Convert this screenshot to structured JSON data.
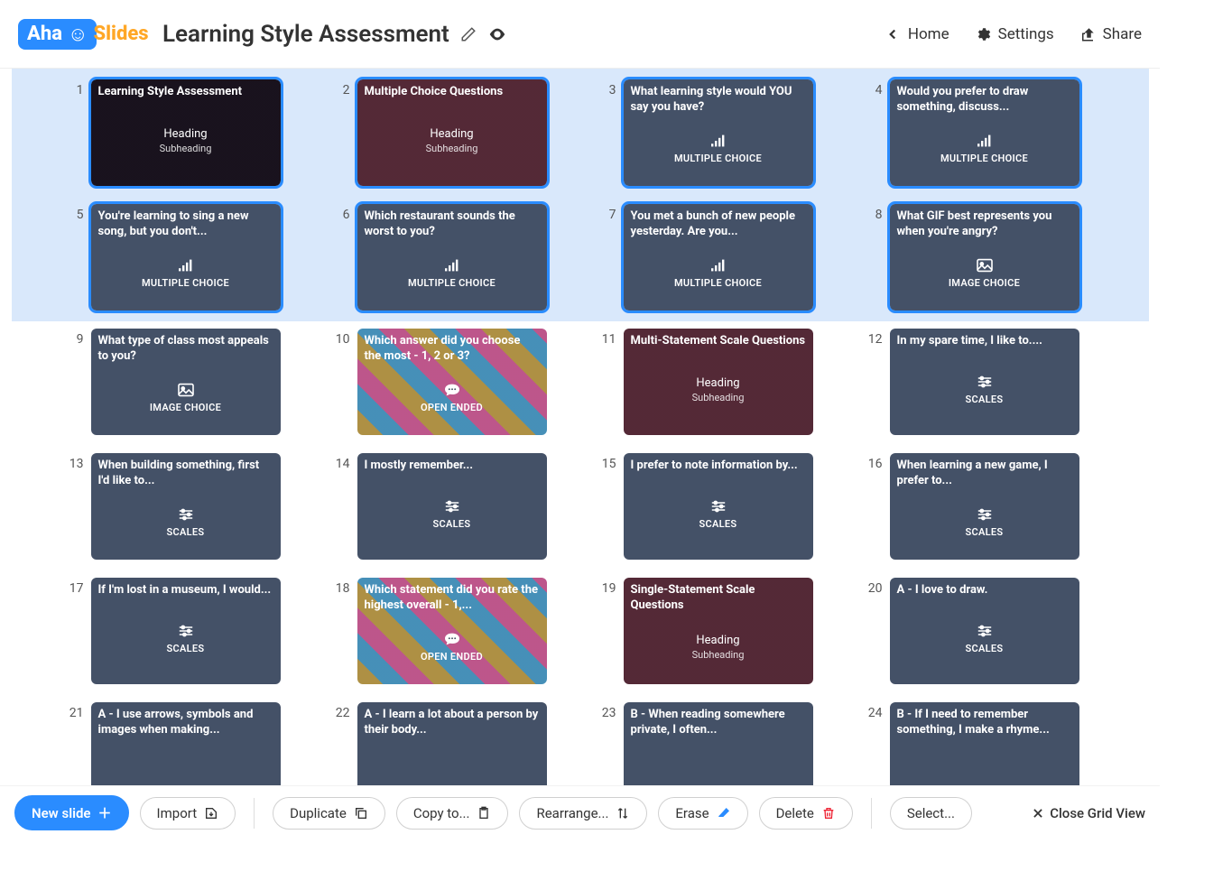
{
  "header": {
    "logo_text1": "Aha",
    "logo_text2": "Slides",
    "title": "Learning Style Assessment",
    "home": "Home",
    "settings": "Settings",
    "share": "Share"
  },
  "slides": [
    {
      "n": 1,
      "title": "Learning Style Assessment",
      "heading": "Heading",
      "sub": "Subheading",
      "type": "",
      "icon": "",
      "bg": "bg-dark",
      "sel": true
    },
    {
      "n": 2,
      "title": "Multiple Choice Questions",
      "heading": "Heading",
      "sub": "Subheading",
      "type": "",
      "icon": "",
      "bg": "bg-burg",
      "sel": true
    },
    {
      "n": 3,
      "title": "What learning style would YOU say you have?",
      "heading": "",
      "sub": "",
      "type": "MULTIPLE CHOICE",
      "icon": "bars",
      "bg": "bg-slate",
      "sel": true
    },
    {
      "n": 4,
      "title": "Would you prefer to draw something, discuss...",
      "heading": "",
      "sub": "",
      "type": "MULTIPLE CHOICE",
      "icon": "bars",
      "bg": "bg-slate",
      "sel": true
    },
    {
      "n": 5,
      "title": "You're learning to sing a new song, but you don't...",
      "heading": "",
      "sub": "",
      "type": "MULTIPLE CHOICE",
      "icon": "bars",
      "bg": "bg-slate",
      "sel": true
    },
    {
      "n": 6,
      "title": "Which restaurant sounds the worst to you?",
      "heading": "",
      "sub": "",
      "type": "MULTIPLE CHOICE",
      "icon": "bars",
      "bg": "bg-slate",
      "sel": true
    },
    {
      "n": 7,
      "title": "You met a bunch of new people yesterday. Are you...",
      "heading": "",
      "sub": "",
      "type": "MULTIPLE CHOICE",
      "icon": "bars",
      "bg": "bg-slate",
      "sel": true
    },
    {
      "n": 8,
      "title": "What GIF best represents you when you're angry?",
      "heading": "",
      "sub": "",
      "type": "IMAGE CHOICE",
      "icon": "image",
      "bg": "bg-slate",
      "sel": true
    },
    {
      "n": 9,
      "title": "What type of class most appeals to you?",
      "heading": "",
      "sub": "",
      "type": "IMAGE CHOICE",
      "icon": "image",
      "bg": "bg-slate",
      "sel": false
    },
    {
      "n": 10,
      "title": "Which answer did you choose the most - 1, 2 or 3?",
      "heading": "",
      "sub": "",
      "type": "OPEN ENDED",
      "icon": "chat",
      "bg": "bg-question",
      "sel": false
    },
    {
      "n": 11,
      "title": "Multi-Statement Scale Questions",
      "heading": "Heading",
      "sub": "Subheading",
      "type": "",
      "icon": "",
      "bg": "bg-burg",
      "sel": false
    },
    {
      "n": 12,
      "title": "In my spare time, I like to....",
      "heading": "",
      "sub": "",
      "type": "SCALES",
      "icon": "sliders",
      "bg": "bg-slate",
      "sel": false
    },
    {
      "n": 13,
      "title": "When building something, first I'd like to...",
      "heading": "",
      "sub": "",
      "type": "SCALES",
      "icon": "sliders",
      "bg": "bg-slate",
      "sel": false
    },
    {
      "n": 14,
      "title": "I mostly remember...",
      "heading": "",
      "sub": "",
      "type": "SCALES",
      "icon": "sliders",
      "bg": "bg-slate",
      "sel": false
    },
    {
      "n": 15,
      "title": "I prefer to note information by...",
      "heading": "",
      "sub": "",
      "type": "SCALES",
      "icon": "sliders",
      "bg": "bg-slate",
      "sel": false
    },
    {
      "n": 16,
      "title": "When learning a new game, I prefer to...",
      "heading": "",
      "sub": "",
      "type": "SCALES",
      "icon": "sliders",
      "bg": "bg-slate",
      "sel": false
    },
    {
      "n": 17,
      "title": "If I'm lost in a museum, I would...",
      "heading": "",
      "sub": "",
      "type": "SCALES",
      "icon": "sliders",
      "bg": "bg-slate",
      "sel": false
    },
    {
      "n": 18,
      "title": "Which statement did you rate the highest overall - 1,...",
      "heading": "",
      "sub": "",
      "type": "OPEN ENDED",
      "icon": "chat",
      "bg": "bg-question",
      "sel": false
    },
    {
      "n": 19,
      "title": "Single-Statement Scale Questions",
      "heading": "Heading",
      "sub": "Subheading",
      "type": "",
      "icon": "",
      "bg": "bg-burg",
      "sel": false
    },
    {
      "n": 20,
      "title": "A - I love to draw.",
      "heading": "",
      "sub": "",
      "type": "SCALES",
      "icon": "sliders",
      "bg": "bg-slate",
      "sel": false
    },
    {
      "n": 21,
      "title": "A - I use arrows, symbols and images when making...",
      "heading": "",
      "sub": "",
      "type": "",
      "icon": "",
      "bg": "bg-slate",
      "sel": false
    },
    {
      "n": 22,
      "title": "A - I learn a lot about a person by their body...",
      "heading": "",
      "sub": "",
      "type": "",
      "icon": "",
      "bg": "bg-slate",
      "sel": false
    },
    {
      "n": 23,
      "title": "B - When reading somewhere private, I often...",
      "heading": "",
      "sub": "",
      "type": "",
      "icon": "",
      "bg": "bg-slate",
      "sel": false
    },
    {
      "n": 24,
      "title": "B - If I need to remember something, I make a rhyme...",
      "heading": "",
      "sub": "",
      "type": "",
      "icon": "",
      "bg": "bg-slate",
      "sel": false
    }
  ],
  "toolbar": {
    "new_slide": "New slide",
    "import": "Import",
    "duplicate": "Duplicate",
    "copy_to": "Copy to...",
    "rearrange": "Rearrange...",
    "erase": "Erase",
    "delete": "Delete",
    "select": "Select...",
    "close_grid": "Close Grid View"
  }
}
